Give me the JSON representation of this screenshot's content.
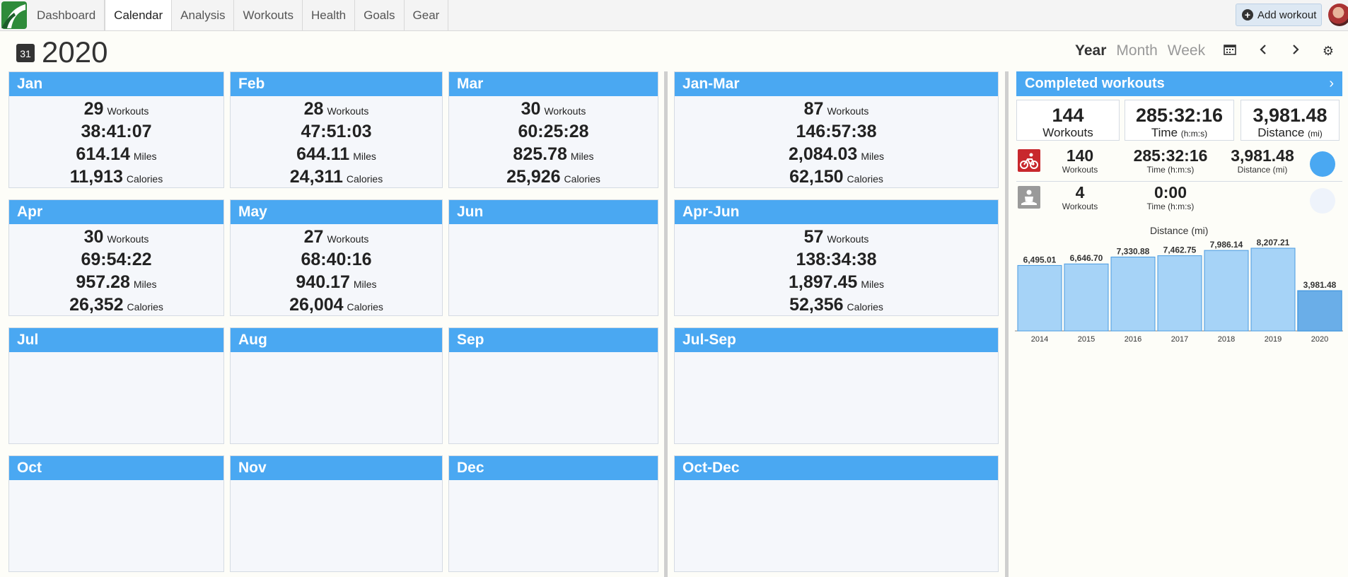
{
  "nav": {
    "tabs": [
      "Dashboard",
      "Calendar",
      "Analysis",
      "Workouts",
      "Health",
      "Goals",
      "Gear"
    ],
    "active": "Calendar",
    "add_workout": "Add workout"
  },
  "header": {
    "calendar_icon_day": "31",
    "year": "2020",
    "views": [
      "Year",
      "Month",
      "Week"
    ],
    "active_view": "Year"
  },
  "units": {
    "workouts": "Workouts",
    "miles": "Miles",
    "calories": "Calories"
  },
  "months": [
    {
      "name": "Jan",
      "workouts": "29",
      "time": "38:41:07",
      "miles": "614.14",
      "calories": "11,913"
    },
    {
      "name": "Feb",
      "workouts": "28",
      "time": "47:51:03",
      "miles": "644.11",
      "calories": "24,311"
    },
    {
      "name": "Mar",
      "workouts": "30",
      "time": "60:25:28",
      "miles": "825.78",
      "calories": "25,926"
    },
    {
      "name": "Apr",
      "workouts": "30",
      "time": "69:54:22",
      "miles": "957.28",
      "calories": "26,352"
    },
    {
      "name": "May",
      "workouts": "27",
      "time": "68:40:16",
      "miles": "940.17",
      "calories": "26,004"
    },
    {
      "name": "Jun"
    },
    {
      "name": "Jul"
    },
    {
      "name": "Aug"
    },
    {
      "name": "Sep"
    },
    {
      "name": "Oct"
    },
    {
      "name": "Nov"
    },
    {
      "name": "Dec"
    }
  ],
  "quarters": [
    {
      "name": "Jan-Mar",
      "workouts": "87",
      "time": "146:57:38",
      "miles": "2,084.03",
      "calories": "62,150"
    },
    {
      "name": "Apr-Jun",
      "workouts": "57",
      "time": "138:34:38",
      "miles": "1,897.45",
      "calories": "52,356"
    },
    {
      "name": "Jul-Sep"
    },
    {
      "name": "Oct-Dec"
    }
  ],
  "summary": {
    "title": "Completed workouts",
    "chevron": "›",
    "totals": [
      {
        "value": "144",
        "label": "Workouts",
        "unit": ""
      },
      {
        "value": "285:32:16",
        "label": "Time",
        "unit": "(h:m:s)"
      },
      {
        "value": "3,981.48",
        "label": "Distance",
        "unit": "(mi)"
      }
    ],
    "activities": [
      {
        "icon": "cycling-icon",
        "color": "#4aa8f2",
        "workouts": "140",
        "workouts_label": "Workouts",
        "time": "285:32:16",
        "time_label": "Time (h:m:s)",
        "distance": "3,981.48",
        "distance_label": "Distance (mi)"
      },
      {
        "icon": "meditation-icon",
        "color": "#eef3fb",
        "workouts": "4",
        "workouts_label": "Workouts",
        "time": "0:00",
        "time_label": "Time (h:m:s)",
        "distance": "",
        "distance_label": ""
      }
    ]
  },
  "chart_data": {
    "type": "bar",
    "title": "Distance (mi)",
    "categories": [
      "2014",
      "2015",
      "2016",
      "2017",
      "2018",
      "2019",
      "2020"
    ],
    "values": [
      6495.01,
      6646.7,
      7330.88,
      7462.75,
      7986.14,
      8207.21,
      3981.48
    ],
    "value_labels": [
      "6,495.01",
      "6,646.70",
      "7,330.88",
      "7,462.75",
      "7,986.14",
      "8,207.21",
      "3,981.48"
    ],
    "highlight": "2020",
    "colors": {
      "bar": "#a6d3f7",
      "highlight": "#6aaee8",
      "border": "#4a9be0"
    }
  }
}
